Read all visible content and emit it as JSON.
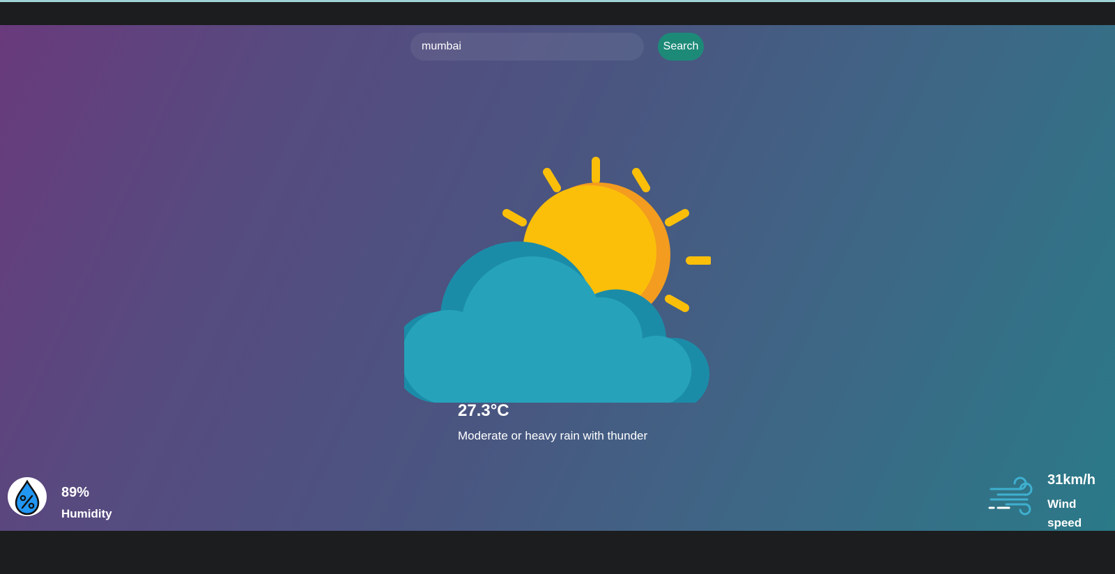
{
  "search": {
    "value": "mumbai",
    "button_label": "Search"
  },
  "weather": {
    "icon": "sun-behind-cloud-icon",
    "temperature": "27.3°C",
    "description": "Moderate or heavy rain with thunder"
  },
  "humidity": {
    "icon": "humidity-drop-icon",
    "value": "89%",
    "label": "Humidity"
  },
  "wind": {
    "icon": "wind-icon",
    "value": "31km/h",
    "label": "Wind speed"
  },
  "colors": {
    "search_button": "#1d8a78",
    "sun": "#fbbf0a",
    "sun_shade": "#f39c1f",
    "cloud": "#26a3bb",
    "cloud_shade": "#1b8ca8",
    "wind_icon": "#3fb0d0",
    "humidity_icon": "#2196f3"
  }
}
